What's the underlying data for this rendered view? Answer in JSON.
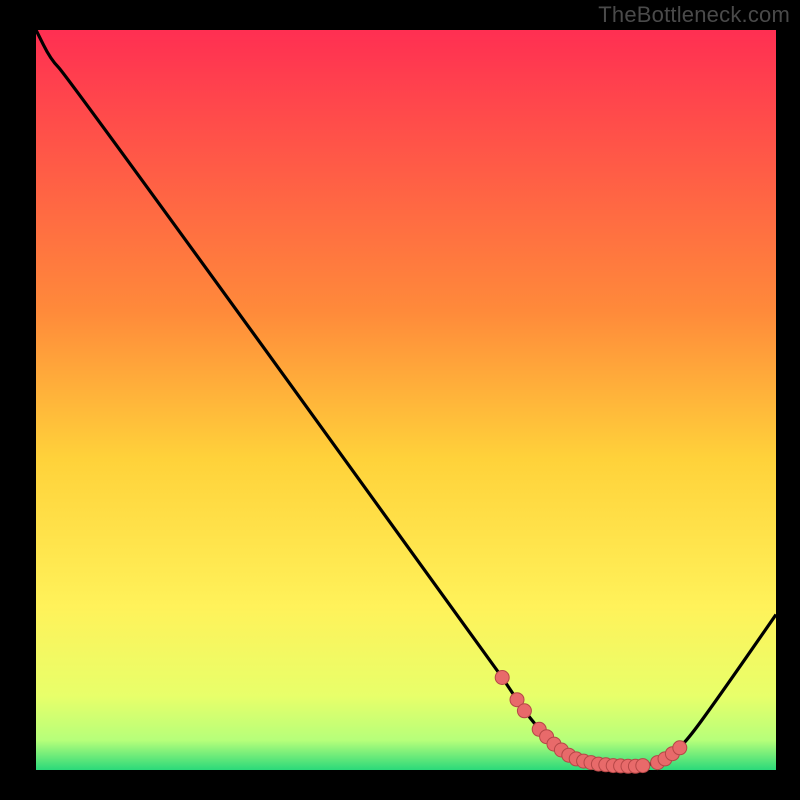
{
  "attribution": "TheBottleneck.com",
  "colors": {
    "bg": "#000000",
    "grad_top": "#ff2f52",
    "grad_mid1": "#ff6a3a",
    "grad_mid2": "#ffd23a",
    "grad_mid3": "#fff25a",
    "grad_mid4": "#f0ff6a",
    "grad_bottom": "#2bd97a",
    "curve": "#000000",
    "marker_fill": "#e86a6a",
    "marker_stroke": "#b54747"
  },
  "chart_data": {
    "type": "line",
    "title": "",
    "xlabel": "",
    "ylabel": "",
    "xlim": [
      0,
      100
    ],
    "ylim": [
      0,
      100
    ],
    "series": [
      {
        "name": "curve",
        "x": [
          0,
          2,
          4,
          62,
          64,
          66,
          68,
          70,
          72,
          74,
          76,
          78,
          80,
          81,
          82,
          84,
          86,
          88,
          92,
          100
        ],
        "y": [
          100,
          96,
          94,
          14,
          11,
          8,
          5.5,
          3.5,
          2,
          1.2,
          0.8,
          0.6,
          0.5,
          0.5,
          0.6,
          1.0,
          2.2,
          4.0,
          9.5,
          21
        ]
      }
    ],
    "markers": {
      "name": "highlight-dots",
      "x": [
        63,
        65,
        66,
        68,
        69,
        70,
        71,
        72,
        73,
        74,
        75,
        76,
        77,
        78,
        79,
        80,
        81,
        82,
        84,
        85,
        86,
        87
      ],
      "y": [
        12.5,
        9.5,
        8,
        5.5,
        4.5,
        3.5,
        2.7,
        2,
        1.5,
        1.2,
        1.0,
        0.8,
        0.7,
        0.6,
        0.55,
        0.5,
        0.5,
        0.6,
        1.0,
        1.5,
        2.2,
        3.0
      ]
    }
  }
}
